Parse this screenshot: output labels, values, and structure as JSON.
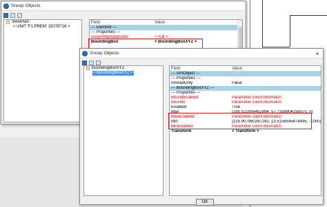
{
  "back_window": {
    "title": "Snoop Objects",
    "tree": [
      {
        "label": "ViewPlan",
        "level": 0,
        "expander": "-"
      },
      {
        "label": "< UNIT 'F1 PREM' 15078716 >",
        "level": 1,
        "expander": ""
      }
    ],
    "grid": {
      "col_field": "Field",
      "col_value": "Value",
      "rows": [
        {
          "field": "--- Element ---",
          "value": "",
          "style": "sec"
        },
        {
          "field": "--- Properties ---",
          "value": "",
          "style": "sub"
        },
        {
          "field": "AssemblyInstanceId",
          "value": "< null >",
          "style": "red"
        },
        {
          "field": "BoundingBox",
          "value": "< BoundingBoxXYZ >",
          "style": "bold"
        }
      ]
    }
  },
  "front_window": {
    "title": "Snoop Objects",
    "tree": [
      {
        "label": "BoundingBoxXYZ",
        "level": 0,
        "expander": "-"
      },
      {
        "label": "< BoundingBoxXYZ >",
        "level": 1,
        "expander": "",
        "selected": true
      }
    ],
    "grid": {
      "col_field": "Field",
      "col_value": "Value",
      "rows": [
        {
          "field": "--- APIObject ---",
          "value": "",
          "style": "sec"
        },
        {
          "field": "--- Properties ---",
          "value": "",
          "style": "sub"
        },
        {
          "field": "IsReadOnly",
          "value": "False",
          "style": "normal"
        },
        {
          "field": "--- BoundingBoxXYZ ---",
          "value": "",
          "style": "sec"
        },
        {
          "field": "--- Properties ---",
          "value": "",
          "style": "sub"
        },
        {
          "field": "BoundEnabled",
          "value": "Parameter count mismatch.",
          "style": "red"
        },
        {
          "field": "Bounds",
          "value": "Parameter count mismatch.",
          "style": "red"
        },
        {
          "field": "Enabled",
          "value": "True",
          "style": "normal"
        },
        {
          "field": "Max",
          "value": "(285.522506452894, 57.7338804158575, 0)",
          "style": "normal"
        },
        {
          "field": "MaxEnabled",
          "value": "Parameter count mismatch.",
          "style": "red"
        },
        {
          "field": "Min",
          "value": "(225.907960267242, 13.5156545874895, -1000)",
          "style": "normal"
        },
        {
          "field": "MinEnabled",
          "value": "Parameter count mismatch.",
          "style": "red"
        },
        {
          "field": "Transform",
          "value": "< Transform >",
          "style": "bold"
        }
      ]
    },
    "ok_label": "OK"
  },
  "colors": {
    "section_row": "#a8d3e6",
    "selection": "#3399ff",
    "error_text": "#d40000",
    "highlight_box": "#e02020"
  }
}
